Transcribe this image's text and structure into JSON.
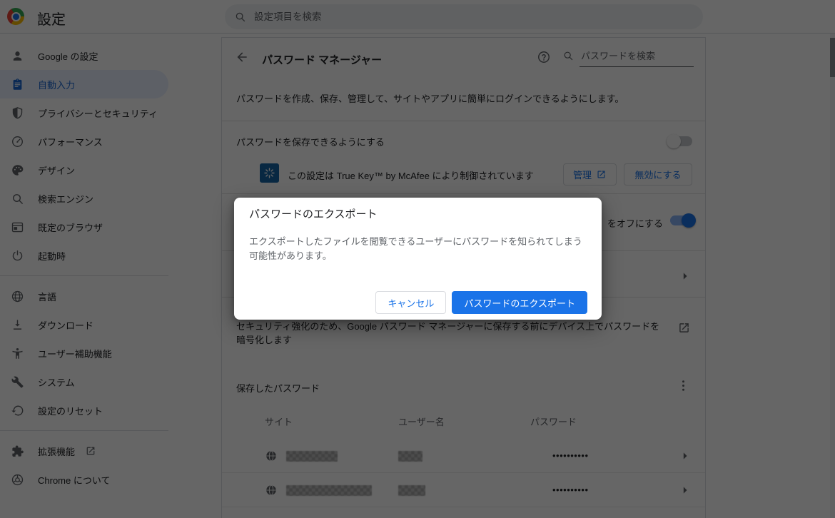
{
  "toolbar": {
    "title": "設定",
    "search_placeholder": "設定項目を検索"
  },
  "sidebar": {
    "items": [
      {
        "id": "google",
        "icon": "person-icon",
        "label": "Google の設定"
      },
      {
        "id": "autofill",
        "icon": "autofill-icon",
        "label": "自動入力",
        "selected": true
      },
      {
        "id": "privacy",
        "icon": "shield-icon",
        "label": "プライバシーとセキュリティ"
      },
      {
        "id": "performance",
        "icon": "speedometer-icon",
        "label": "パフォーマンス"
      },
      {
        "id": "appearance",
        "icon": "palette-icon",
        "label": "デザイン"
      },
      {
        "id": "search-engine",
        "icon": "search-icon",
        "label": "検索エンジン"
      },
      {
        "id": "default-browser",
        "icon": "browser-icon",
        "label": "既定のブラウザ"
      },
      {
        "id": "startup",
        "icon": "power-icon",
        "label": "起動時",
        "divider_after": true
      },
      {
        "id": "languages",
        "icon": "globe-icon",
        "label": "言語"
      },
      {
        "id": "downloads",
        "icon": "download-icon",
        "label": "ダウンロード"
      },
      {
        "id": "accessibility",
        "icon": "accessibility-icon",
        "label": "ユーザー補助機能"
      },
      {
        "id": "system",
        "icon": "wrench-icon",
        "label": "システム"
      },
      {
        "id": "reset",
        "icon": "history-icon",
        "label": "設定のリセット",
        "divider_after": true
      },
      {
        "id": "extensions",
        "icon": "puzzle-icon",
        "label": "拡張機能",
        "external": true
      },
      {
        "id": "about",
        "icon": "chrome-icon",
        "label": "Chrome について"
      }
    ]
  },
  "main": {
    "header": {
      "title": "パスワード マネージャー",
      "search_placeholder": "パスワードを検索"
    },
    "description": "パスワードを作成、保存、管理して、サイトやアプリに簡単にログインできるようにします。",
    "save_passwords_row": {
      "label": "パスワードを保存できるようにする",
      "toggle": "off"
    },
    "extension_control_row": {
      "text": "この設定は True Key™ by McAfee により制御されています",
      "manage_label": "管理",
      "disable_label": "無効にする"
    },
    "partially_hidden_row": {
      "visible_label": "をオフにする",
      "toggle": "on"
    },
    "encryption_row": {
      "text": "セキュリティ強化のため、Google パスワード マネージャーに保存する前にデバイス上でパスワードを暗号化します"
    },
    "saved_passwords": {
      "title": "保存したパスワード",
      "columns": [
        "サイト",
        "ユーザー名",
        "パスワード"
      ],
      "rows": [
        {
          "site_redacted": true,
          "username_redacted": true,
          "password_mask": "••••••••••",
          "site_block_width": 72,
          "username_block_width": 34
        },
        {
          "site_redacted": true,
          "username_redacted": true,
          "password_mask": "••••••••••",
          "site_block_width": 120,
          "username_block_width": 38
        }
      ]
    }
  },
  "dialog": {
    "title": "パスワードのエクスポート",
    "body": "エクスポートしたファイルを閲覧できるユーザーにパスワードを知られてしまう可能性があります。",
    "cancel_label": "キャンセル",
    "confirm_label": "パスワードのエクスポート"
  },
  "colors": {
    "accent": "#1a73e8",
    "selected_nav_bg": "#e8f0fe",
    "selected_nav_text": "#1967d2",
    "scrim": "rgba(0,0,0,0.6)",
    "truekey_tile": "#1464a5",
    "toggle_on_track": "#8ab4f8"
  }
}
